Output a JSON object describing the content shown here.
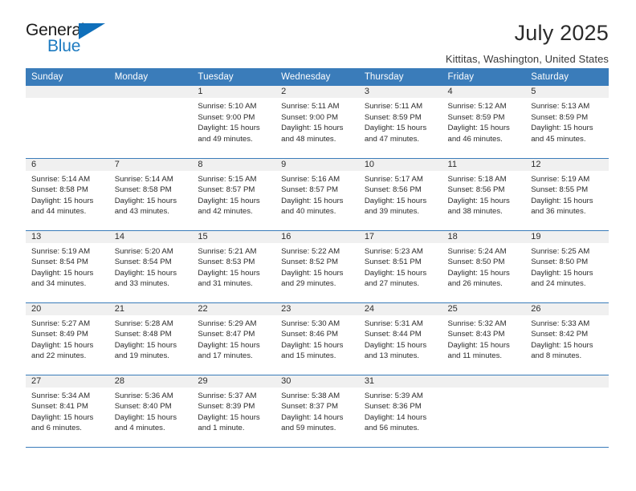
{
  "brand": {
    "name_top": "General",
    "name_bottom": "Blue",
    "triangle_icon": "triangle-icon",
    "accent_color": "#1c7ac0",
    "header_color": "#3a7cba"
  },
  "header": {
    "title": "July 2025",
    "subtitle": "Kittitas, Washington, United States"
  },
  "calendar": {
    "weekday_headers": [
      "Sunday",
      "Monday",
      "Tuesday",
      "Wednesday",
      "Thursday",
      "Friday",
      "Saturday"
    ],
    "weeks": [
      [
        {
          "day": "",
          "lines": []
        },
        {
          "day": "",
          "lines": []
        },
        {
          "day": "1",
          "lines": [
            "Sunrise: 5:10 AM",
            "Sunset: 9:00 PM",
            "Daylight: 15 hours",
            "and 49 minutes."
          ]
        },
        {
          "day": "2",
          "lines": [
            "Sunrise: 5:11 AM",
            "Sunset: 9:00 PM",
            "Daylight: 15 hours",
            "and 48 minutes."
          ]
        },
        {
          "day": "3",
          "lines": [
            "Sunrise: 5:11 AM",
            "Sunset: 8:59 PM",
            "Daylight: 15 hours",
            "and 47 minutes."
          ]
        },
        {
          "day": "4",
          "lines": [
            "Sunrise: 5:12 AM",
            "Sunset: 8:59 PM",
            "Daylight: 15 hours",
            "and 46 minutes."
          ]
        },
        {
          "day": "5",
          "lines": [
            "Sunrise: 5:13 AM",
            "Sunset: 8:59 PM",
            "Daylight: 15 hours",
            "and 45 minutes."
          ]
        }
      ],
      [
        {
          "day": "6",
          "lines": [
            "Sunrise: 5:14 AM",
            "Sunset: 8:58 PM",
            "Daylight: 15 hours",
            "and 44 minutes."
          ]
        },
        {
          "day": "7",
          "lines": [
            "Sunrise: 5:14 AM",
            "Sunset: 8:58 PM",
            "Daylight: 15 hours",
            "and 43 minutes."
          ]
        },
        {
          "day": "8",
          "lines": [
            "Sunrise: 5:15 AM",
            "Sunset: 8:57 PM",
            "Daylight: 15 hours",
            "and 42 minutes."
          ]
        },
        {
          "day": "9",
          "lines": [
            "Sunrise: 5:16 AM",
            "Sunset: 8:57 PM",
            "Daylight: 15 hours",
            "and 40 minutes."
          ]
        },
        {
          "day": "10",
          "lines": [
            "Sunrise: 5:17 AM",
            "Sunset: 8:56 PM",
            "Daylight: 15 hours",
            "and 39 minutes."
          ]
        },
        {
          "day": "11",
          "lines": [
            "Sunrise: 5:18 AM",
            "Sunset: 8:56 PM",
            "Daylight: 15 hours",
            "and 38 minutes."
          ]
        },
        {
          "day": "12",
          "lines": [
            "Sunrise: 5:19 AM",
            "Sunset: 8:55 PM",
            "Daylight: 15 hours",
            "and 36 minutes."
          ]
        }
      ],
      [
        {
          "day": "13",
          "lines": [
            "Sunrise: 5:19 AM",
            "Sunset: 8:54 PM",
            "Daylight: 15 hours",
            "and 34 minutes."
          ]
        },
        {
          "day": "14",
          "lines": [
            "Sunrise: 5:20 AM",
            "Sunset: 8:54 PM",
            "Daylight: 15 hours",
            "and 33 minutes."
          ]
        },
        {
          "day": "15",
          "lines": [
            "Sunrise: 5:21 AM",
            "Sunset: 8:53 PM",
            "Daylight: 15 hours",
            "and 31 minutes."
          ]
        },
        {
          "day": "16",
          "lines": [
            "Sunrise: 5:22 AM",
            "Sunset: 8:52 PM",
            "Daylight: 15 hours",
            "and 29 minutes."
          ]
        },
        {
          "day": "17",
          "lines": [
            "Sunrise: 5:23 AM",
            "Sunset: 8:51 PM",
            "Daylight: 15 hours",
            "and 27 minutes."
          ]
        },
        {
          "day": "18",
          "lines": [
            "Sunrise: 5:24 AM",
            "Sunset: 8:50 PM",
            "Daylight: 15 hours",
            "and 26 minutes."
          ]
        },
        {
          "day": "19",
          "lines": [
            "Sunrise: 5:25 AM",
            "Sunset: 8:50 PM",
            "Daylight: 15 hours",
            "and 24 minutes."
          ]
        }
      ],
      [
        {
          "day": "20",
          "lines": [
            "Sunrise: 5:27 AM",
            "Sunset: 8:49 PM",
            "Daylight: 15 hours",
            "and 22 minutes."
          ]
        },
        {
          "day": "21",
          "lines": [
            "Sunrise: 5:28 AM",
            "Sunset: 8:48 PM",
            "Daylight: 15 hours",
            "and 19 minutes."
          ]
        },
        {
          "day": "22",
          "lines": [
            "Sunrise: 5:29 AM",
            "Sunset: 8:47 PM",
            "Daylight: 15 hours",
            "and 17 minutes."
          ]
        },
        {
          "day": "23",
          "lines": [
            "Sunrise: 5:30 AM",
            "Sunset: 8:46 PM",
            "Daylight: 15 hours",
            "and 15 minutes."
          ]
        },
        {
          "day": "24",
          "lines": [
            "Sunrise: 5:31 AM",
            "Sunset: 8:44 PM",
            "Daylight: 15 hours",
            "and 13 minutes."
          ]
        },
        {
          "day": "25",
          "lines": [
            "Sunrise: 5:32 AM",
            "Sunset: 8:43 PM",
            "Daylight: 15 hours",
            "and 11 minutes."
          ]
        },
        {
          "day": "26",
          "lines": [
            "Sunrise: 5:33 AM",
            "Sunset: 8:42 PM",
            "Daylight: 15 hours",
            "and 8 minutes."
          ]
        }
      ],
      [
        {
          "day": "27",
          "lines": [
            "Sunrise: 5:34 AM",
            "Sunset: 8:41 PM",
            "Daylight: 15 hours",
            "and 6 minutes."
          ]
        },
        {
          "day": "28",
          "lines": [
            "Sunrise: 5:36 AM",
            "Sunset: 8:40 PM",
            "Daylight: 15 hours",
            "and 4 minutes."
          ]
        },
        {
          "day": "29",
          "lines": [
            "Sunrise: 5:37 AM",
            "Sunset: 8:39 PM",
            "Daylight: 15 hours",
            "and 1 minute."
          ]
        },
        {
          "day": "30",
          "lines": [
            "Sunrise: 5:38 AM",
            "Sunset: 8:37 PM",
            "Daylight: 14 hours",
            "and 59 minutes."
          ]
        },
        {
          "day": "31",
          "lines": [
            "Sunrise: 5:39 AM",
            "Sunset: 8:36 PM",
            "Daylight: 14 hours",
            "and 56 minutes."
          ]
        },
        {
          "day": "",
          "lines": []
        },
        {
          "day": "",
          "lines": []
        }
      ]
    ]
  }
}
